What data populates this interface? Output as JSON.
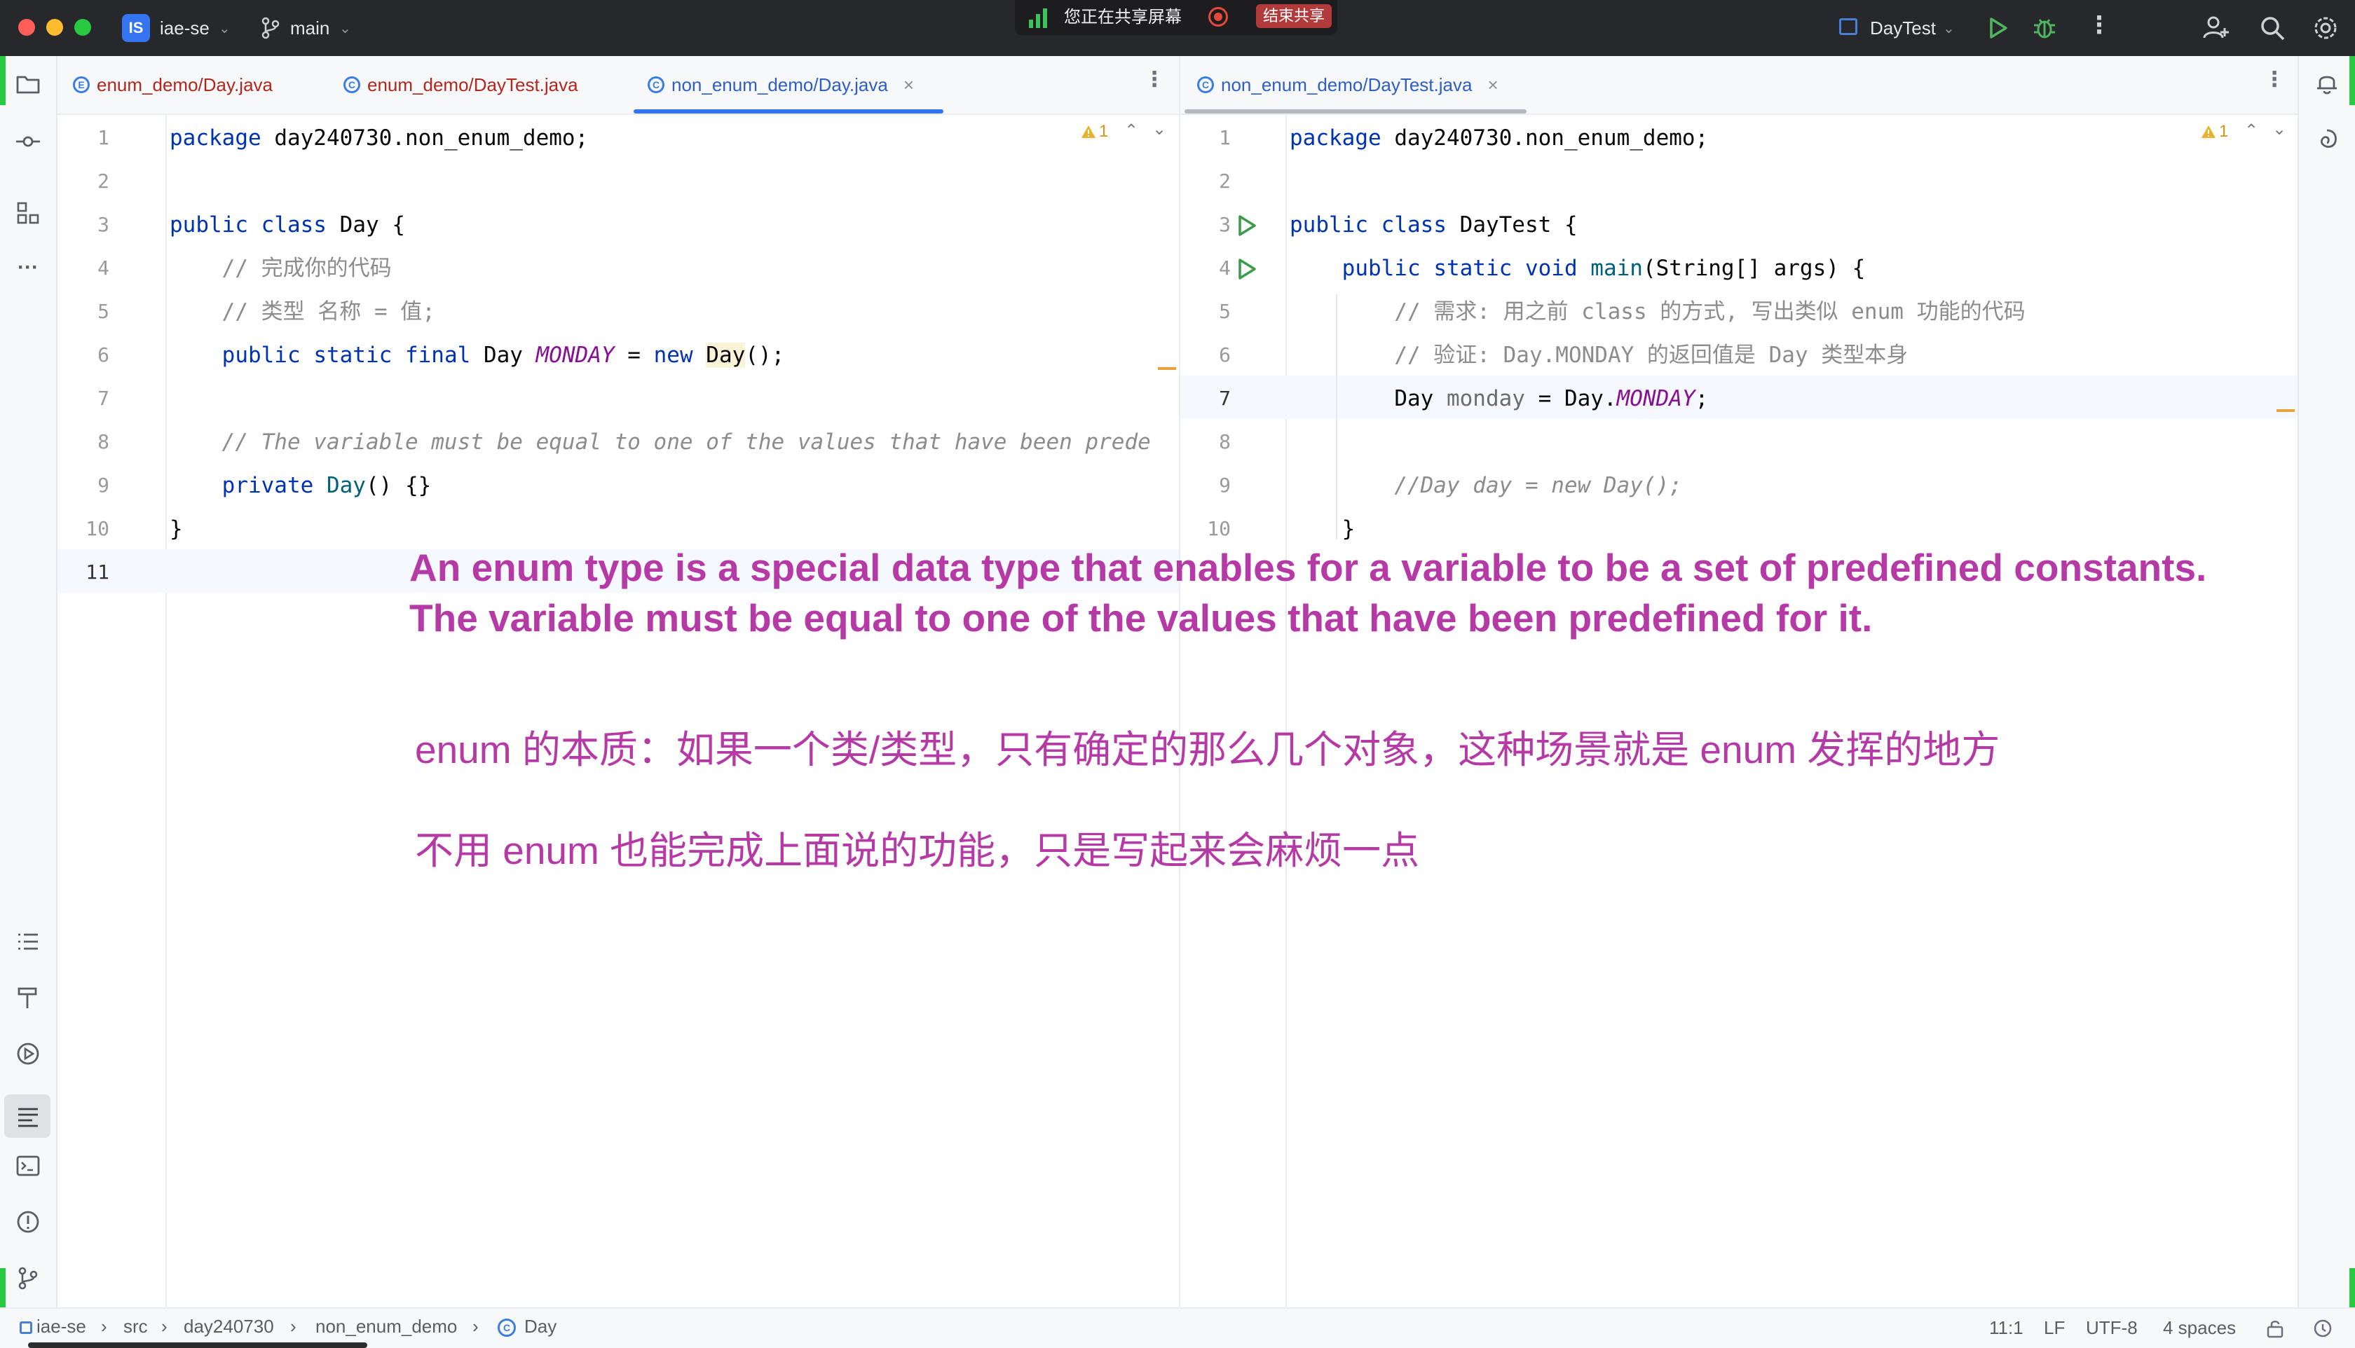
{
  "titlebar": {
    "project_badge": "IS",
    "project_name": "iae-se",
    "branch": "main",
    "sharing_text": "您正在共享屏幕",
    "end_share": "结束共享",
    "run_config": "DayTest"
  },
  "left_tabs": [
    {
      "label": "enum_demo/Day.java",
      "active": false
    },
    {
      "label": "enum_demo/DayTest.java",
      "active": false
    },
    {
      "label": "non_enum_demo/Day.java",
      "active": true
    }
  ],
  "right_tabs": [
    {
      "label": "non_enum_demo/DayTest.java",
      "active": true
    }
  ],
  "left_editor": {
    "warning_count": "1",
    "line_numbers": [
      "1",
      "2",
      "3",
      "4",
      "5",
      "6",
      "7",
      "8",
      "9",
      "10",
      "11"
    ],
    "current_line": "11"
  },
  "right_editor": {
    "warning_count": "1",
    "line_numbers": [
      "1",
      "2",
      "3",
      "4",
      "5",
      "6",
      "7",
      "8",
      "9",
      "10"
    ],
    "current_line": "7"
  },
  "code_tokens": {
    "package": "package",
    "left_package_name": " day240730.non_enum_demo;",
    "public": "public",
    "class": "class",
    "static": "static",
    "final": "final",
    "new": "new",
    "void": "void",
    "private": "private",
    "day_class": "Day",
    "daytest_class": "DayTest",
    "open_brace": " {",
    "close_brace": "}",
    "comment_todo": "// 完成你的代码",
    "comment_type_name": "// 类型 名称 = 值;",
    "monday": "MONDAY",
    "eq": " = ",
    "ctor_call": "();",
    "comment_variable": "// The variable must be equal to one of the values that have been prede",
    "private_ctor": "() {}",
    "main": "main",
    "main_args": "(String[] args) {",
    "comment_need": "// 需求: 用之前 class 的方式, 写出类似 enum 功能的代码",
    "comment_verify": "// 验证: Day.MONDAY 的返回值是 Day 类型本身",
    "day_type": "Day",
    "var_monday": "monday",
    "day_dot": "Day.",
    "semicolon": ";",
    "comment_new_day": "//Day day = new Day();"
  },
  "overlay": {
    "line1": "An enum type is a special data type that enables for a variable to be a set of predefined constants.",
    "line2": "The variable must be equal to one of the values that have been predefined for it.",
    "zh1": "enum 的本质：如果一个类/类型，只有确定的那么几个对象，这种场景就是 enum 发挥的地方",
    "zh2": "不用 enum 也能完成上面说的功能，只是写起来会麻烦一点"
  },
  "statusbar": {
    "breadcrumbs": [
      "iae-se",
      "src",
      "day240730",
      "non_enum_demo",
      "Day"
    ],
    "position": "11:1",
    "line_sep": "LF",
    "encoding": "UTF-8",
    "indent": "4 spaces"
  },
  "colors": {
    "accent": "#3574f0",
    "overlay_text": "#b53aa6",
    "keyword": "#0033b3",
    "comment": "#8c8c8c",
    "field": "#871094"
  }
}
